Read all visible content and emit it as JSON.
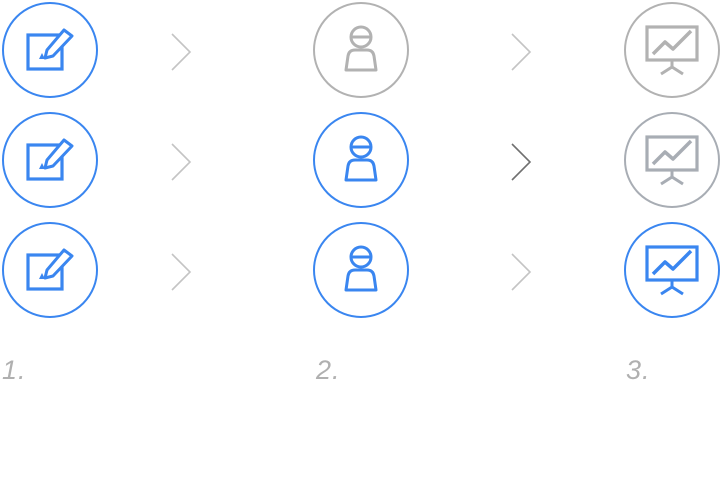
{
  "colors": {
    "active": "#3a86f0",
    "inactive": "#b2b2b2",
    "inactive_alt": "#a8adb4",
    "arrow_light": "#c4c4c4",
    "arrow_dark": "#707070",
    "label": "#b0b0b0"
  },
  "rows": [
    {
      "steps": [
        {
          "icon": "edit-icon",
          "state": "active"
        },
        {
          "icon": "user-icon",
          "state": "inactive"
        },
        {
          "icon": "presentation-chart-icon",
          "state": "inactive"
        }
      ],
      "arrows": [
        "light",
        "light"
      ]
    },
    {
      "steps": [
        {
          "icon": "edit-icon",
          "state": "active"
        },
        {
          "icon": "user-icon",
          "state": "active"
        },
        {
          "icon": "presentation-chart-icon",
          "state": "inactive-alt"
        }
      ],
      "arrows": [
        "light",
        "dark"
      ]
    },
    {
      "steps": [
        {
          "icon": "edit-icon",
          "state": "active"
        },
        {
          "icon": "user-icon",
          "state": "active"
        },
        {
          "icon": "presentation-chart-icon",
          "state": "active"
        }
      ],
      "arrows": [
        "light",
        "light"
      ]
    }
  ],
  "labels": [
    "1.",
    "2.",
    "3."
  ]
}
